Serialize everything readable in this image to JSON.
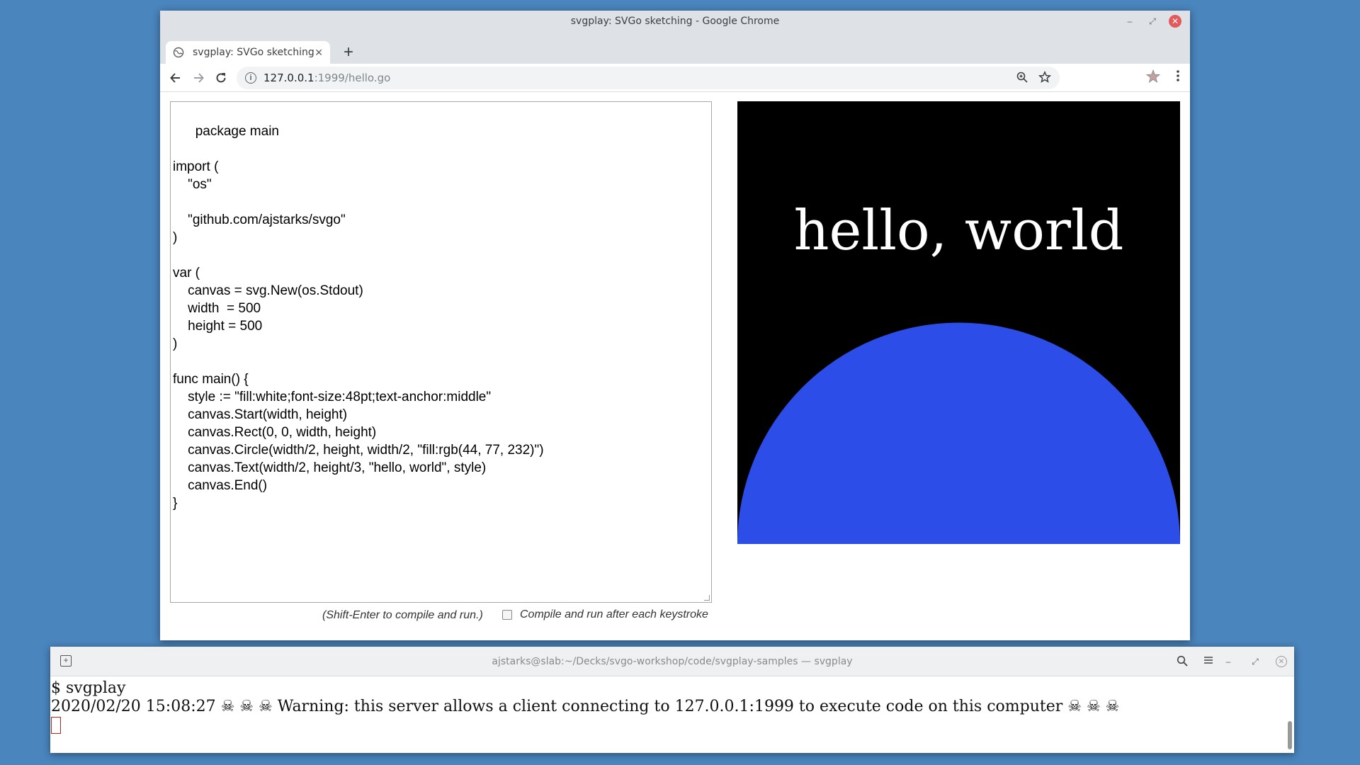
{
  "chrome": {
    "window_title": "svgplay: SVGo sketching - Google Chrome",
    "tab_title": "svgplay: SVGo sketching",
    "tab_close": "✕",
    "new_tab": "+",
    "url_host": "127.0.0.1",
    "url_path": ":1999/hello.go",
    "icons": [
      "back-icon",
      "forward-icon",
      "reload-icon",
      "site-info-icon",
      "zoom-icon",
      "bookmark-star-icon",
      "extension-icon",
      "menu-icon"
    ]
  },
  "editor": {
    "code": "package main\n\nimport (\n\t\"os\"\n\n\t\"github.com/ajstarks/svgo\"\n)\n\nvar (\n\tcanvas = svg.New(os.Stdout)\n\twidth  = 500\n\theight = 500\n)\n\nfunc main() {\n\tstyle := \"fill:white;font-size:48pt;text-anchor:middle\"\n\tcanvas.Start(width, height)\n\tcanvas.Rect(0, 0, width, height)\n\tcanvas.Circle(width/2, height, width/2, \"fill:rgb(44, 77, 232)\")\n\tcanvas.Text(width/2, height/3, \"hello, world\", style)\n\tcanvas.End()\n}",
    "hint": "(Shift-Enter to compile and run.)",
    "autorun_label": "Compile and run after each keystroke",
    "autorun_checked": false
  },
  "output": {
    "text": "hello, world",
    "background": "#000000",
    "circle_fill": "#2c4de8",
    "text_fill": "#ffffff"
  },
  "terminal": {
    "title": "ajstarks@slab:~/Decks/svgo-workshop/code/svgplay-samples — svgplay",
    "line1": "$ svgplay",
    "line2": "2020/02/20 15:08:27 ☠ ☠ ☠ Warning: this server allows a client connecting to 127.0.0.1:1999 to execute code on this computer ☠ ☠ ☠"
  }
}
